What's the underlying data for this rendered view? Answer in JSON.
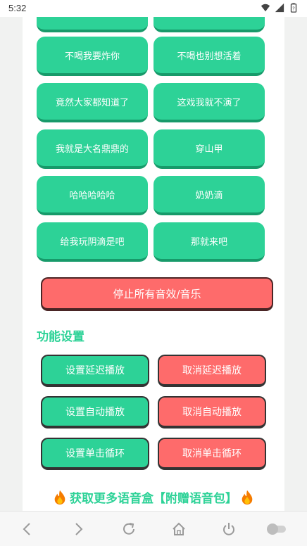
{
  "status": {
    "time": "5:32"
  },
  "sound_buttons": [
    {
      "label": "不喝我要炸你"
    },
    {
      "label": "不喝也别想活着"
    },
    {
      "label": "竟然大家都知道了"
    },
    {
      "label": "这戏我就不演了"
    },
    {
      "label": "我就是大名鼎鼎的"
    },
    {
      "label": "穿山甲"
    },
    {
      "label": "哈哈哈哈哈"
    },
    {
      "label": "奶奶滴"
    },
    {
      "label": "给我玩阴滴是吧"
    },
    {
      "label": "那就来吧"
    }
  ],
  "stop_all_label": "停止所有音效/音乐",
  "settings": {
    "title": "功能设置",
    "set_delay": "设置延迟播放",
    "cancel_delay": "取消延迟播放",
    "set_auto": "设置自动播放",
    "cancel_auto": "取消自动播放",
    "set_loop": "设置单击循环",
    "cancel_loop": "取消单击循环"
  },
  "promo_text": "获取更多语音盒【附赠语音包】",
  "colors": {
    "green": "#2dd297",
    "red": "#fe6b6b"
  },
  "icons": [
    "wifi-icon",
    "signal-icon",
    "battery-icon",
    "fire-icon",
    "back-arrow-icon",
    "forward-arrow-icon",
    "refresh-icon",
    "home-icon",
    "power-icon",
    "toggle-icon"
  ]
}
